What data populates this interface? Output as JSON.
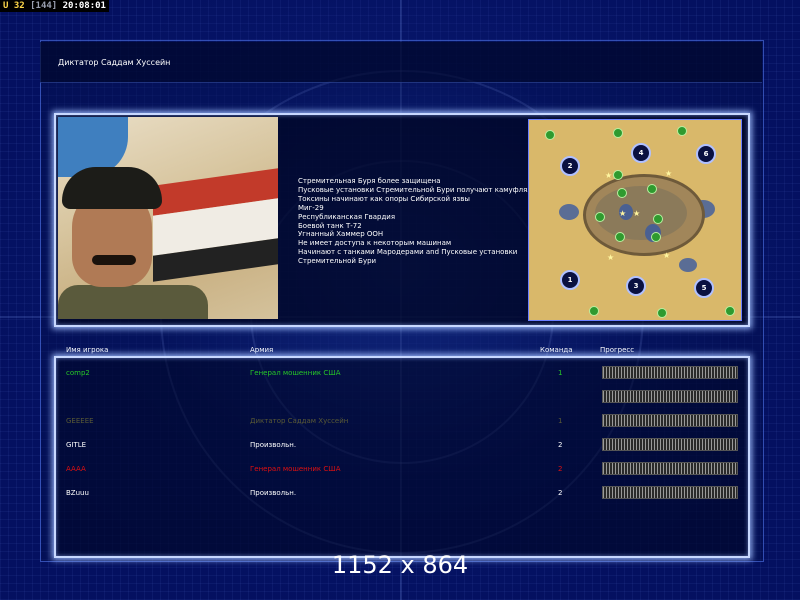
{
  "hud": {
    "unit_label": "U 32",
    "frames": "[144]",
    "clock": "20:08:01"
  },
  "screen": {
    "title": "Диктатор Саддам Хуссейн",
    "portrait_icon": "general-portrait",
    "description": [
      "Стремительная Буря более защищена",
      "Пусковые установки Стремительной Бури получают камуфляж",
      "Токсины начинают как опоры Сибирской язвы",
      "Миг-29",
      "Республиканская Гвардия",
      "Боевой танк Т-72",
      "Угнанный Хаммер ООН",
      "Не имеет доступа к некоторым машинам",
      "Начинают с танками Мародерами and Пусковые установки",
      " Стремительной Бури"
    ]
  },
  "minimap": {
    "start_positions": [
      "1",
      "2",
      "3",
      "4",
      "5",
      "6"
    ],
    "resource_icon": "cash-pile-icon",
    "oil_icon": "oil-derrick-icon"
  },
  "players_table": {
    "headers": {
      "name": "Имя игрока",
      "army": "Армия",
      "team": "Команда",
      "progress": "Прогресс"
    },
    "rows": [
      {
        "name": "comp2",
        "army": "Генерал мошенник США",
        "team": "1",
        "color": "#27c827"
      },
      {
        "name": "",
        "army": "",
        "team": "",
        "color": "#ffffff"
      },
      {
        "name": "GEEEEE",
        "army": "Диктатор Саддам Хуссейн",
        "team": "1",
        "color": "#5a5a36"
      },
      {
        "name": "GITLE",
        "army": "Произвольн.",
        "team": "2",
        "color": "#ffffff"
      },
      {
        "name": "AAAA",
        "army": "Генерал мошенник США",
        "team": "2",
        "color": "#e01010"
      },
      {
        "name": "BZuuu",
        "army": "Произвольн.",
        "team": "2",
        "color": "#ffffff"
      }
    ]
  },
  "resolution": "1152 x 864"
}
